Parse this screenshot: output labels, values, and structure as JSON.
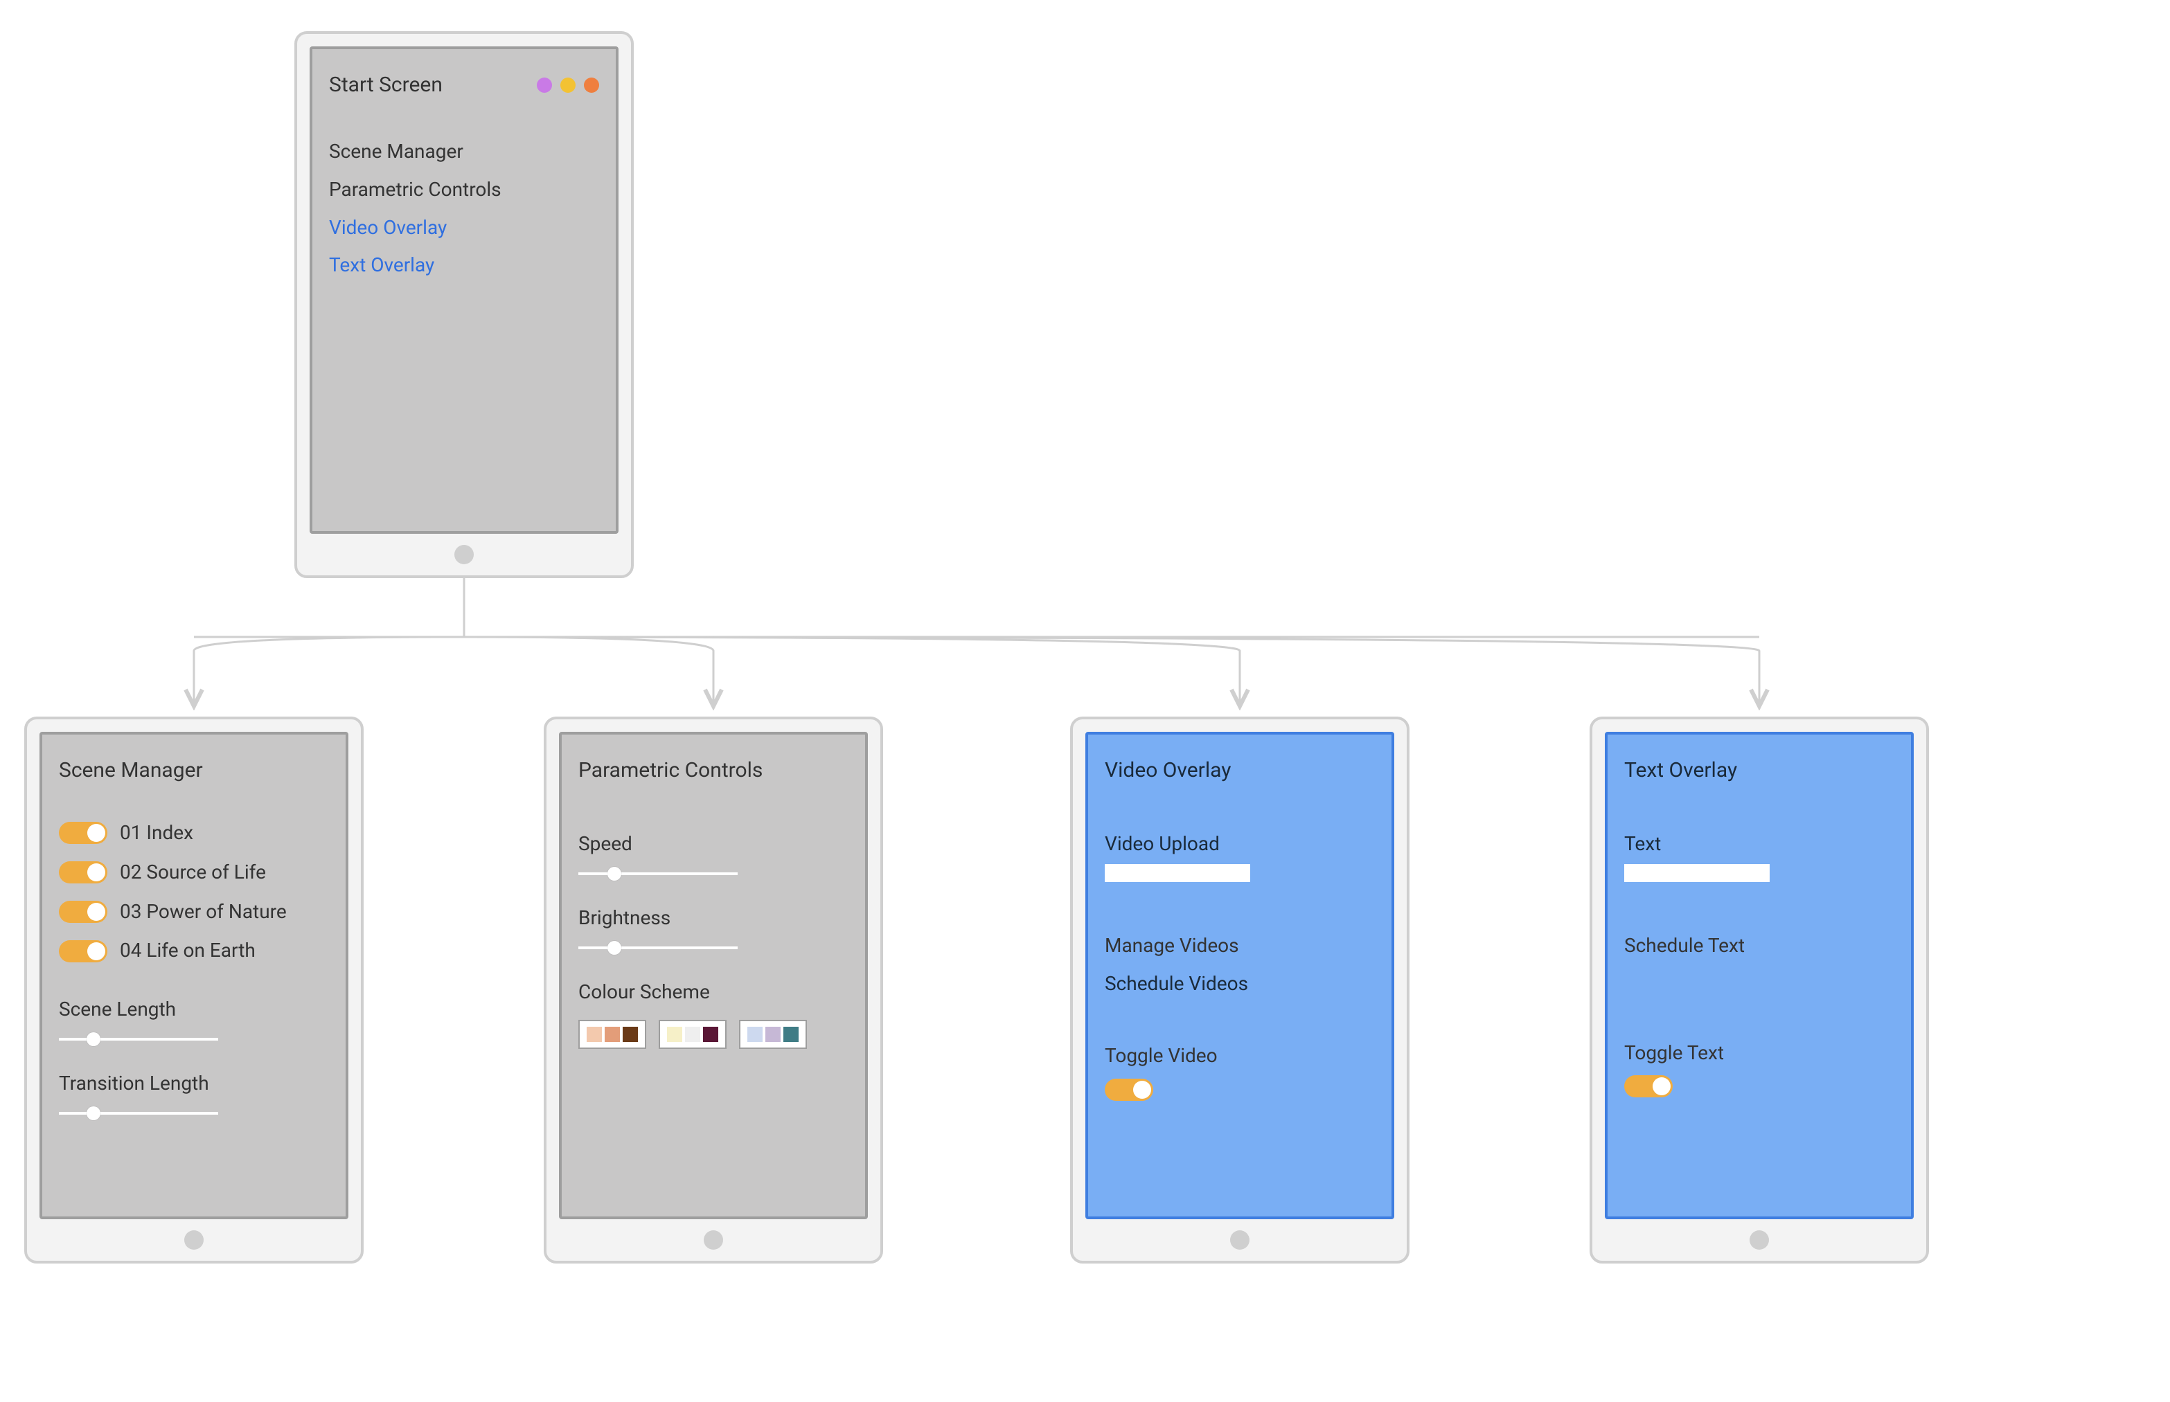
{
  "startScreen": {
    "title": "Start Screen",
    "dots": [
      "#c97ae6",
      "#f3c233",
      "#ef7f3f"
    ],
    "links": [
      {
        "label": "Scene Manager",
        "style": "plain"
      },
      {
        "label": "Parametric Controls",
        "style": "plain"
      },
      {
        "label": "Video Overlay",
        "style": "blue"
      },
      {
        "label": "Text Overlay",
        "style": "blue"
      }
    ]
  },
  "sceneManager": {
    "title": "Scene Manager",
    "scenes": [
      {
        "label": "01 Index"
      },
      {
        "label": "02 Source of Life"
      },
      {
        "label": "03 Power of Nature"
      },
      {
        "label": "04 Life on Earth"
      }
    ],
    "sceneLengthLabel": "Scene Length",
    "transitionLengthLabel": "Transition Length"
  },
  "parametricControls": {
    "title": "Parametric Controls",
    "speedLabel": "Speed",
    "brightnessLabel": "Brightness",
    "colourSchemeLabel": "Colour Scheme",
    "swatchGroups": [
      [
        "#f3c9ad",
        "#e39d79",
        "#6a3a17"
      ],
      [
        "#f6f0c8",
        "#efefef",
        "#5a1736"
      ],
      [
        "#cdd9ef",
        "#c6b8d6",
        "#3f7c85"
      ]
    ]
  },
  "videoOverlay": {
    "title": "Video Overlay",
    "uploadLabel": "Video Upload",
    "manageLabel": "Manage Videos",
    "scheduleLabel": "Schedule Videos",
    "toggleLabel": "Toggle Video"
  },
  "textOverlay": {
    "title": "Text Overlay",
    "textLabel": "Text",
    "scheduleLabel": "Schedule Text",
    "toggleLabel": "Toggle Text"
  }
}
